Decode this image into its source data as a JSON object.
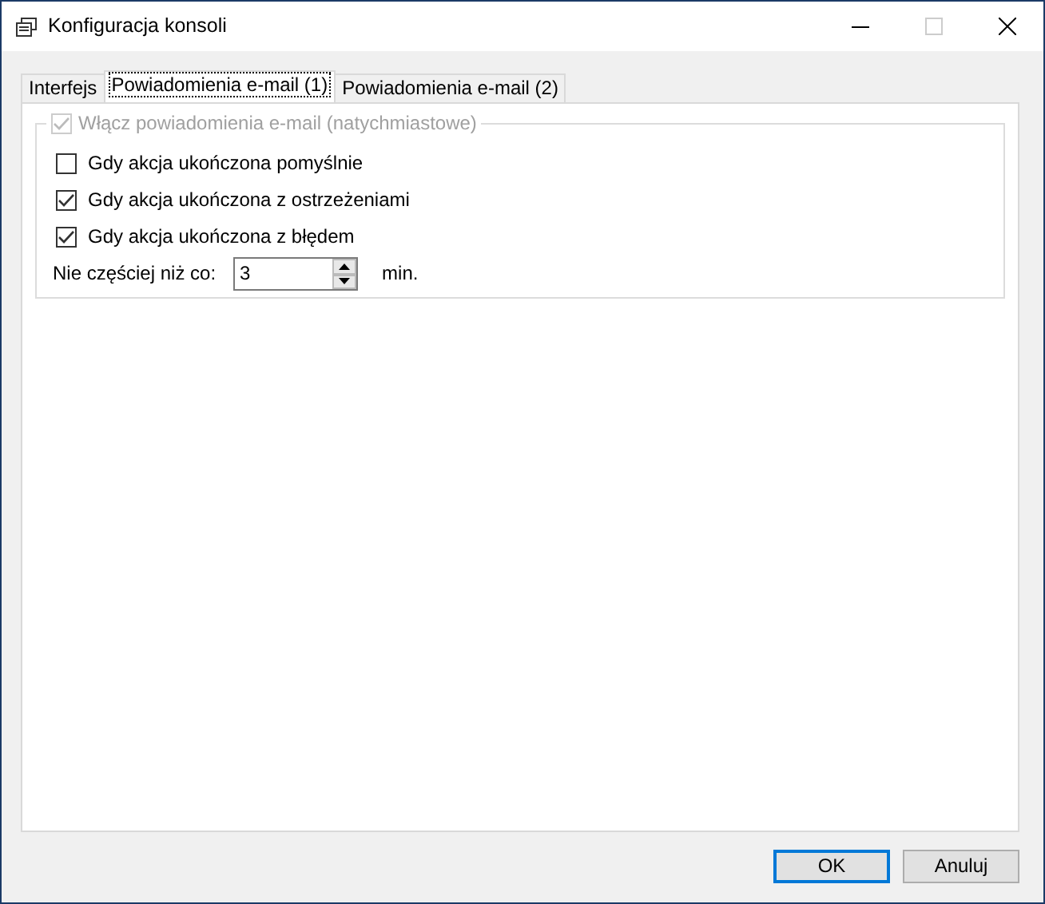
{
  "window": {
    "title": "Konfiguracja konsoli",
    "maximize_disabled": true
  },
  "tabs": [
    {
      "label": "Interfejs",
      "selected": false
    },
    {
      "label": "Powiadomienia e-mail (1)",
      "selected": true
    },
    {
      "label": "Powiadomienia e-mail (2)",
      "selected": false
    }
  ],
  "group": {
    "label": "Włącz powiadomienia e-mail (natychmiastowe)",
    "checked": true,
    "disabled": true
  },
  "options": [
    {
      "label": "Gdy akcja ukończona pomyślnie",
      "checked": false
    },
    {
      "label": "Gdy akcja ukończona z ostrzeżeniami",
      "checked": true
    },
    {
      "label": "Gdy akcja ukończona z błędem",
      "checked": true
    }
  ],
  "interval": {
    "label": "Nie częściej niż co:",
    "value": "3",
    "unit": "min."
  },
  "buttons": [
    {
      "label": "OK",
      "default": true
    },
    {
      "label": "Anuluj",
      "default": false
    }
  ]
}
